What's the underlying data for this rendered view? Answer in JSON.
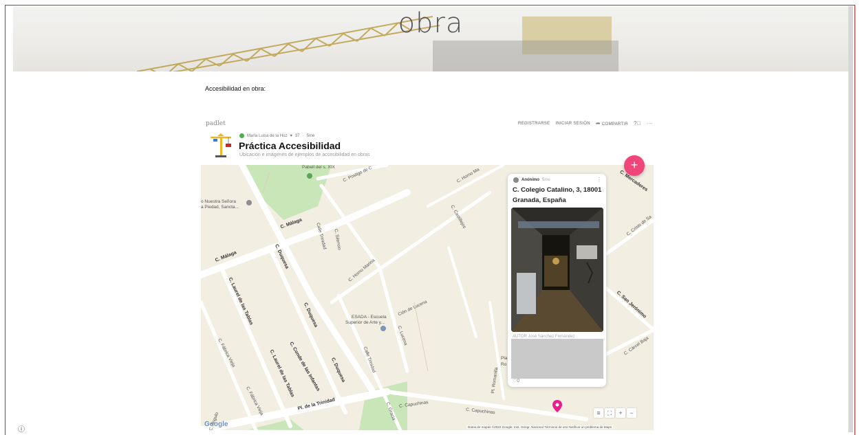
{
  "banner": {
    "title": "obra"
  },
  "intro_text": "Accesibilidad en obra:",
  "padlet": {
    "logo": "padlet",
    "nav": {
      "register": "REGISTRARSE",
      "login": "INICIAR SESIÓN",
      "share": "COMPARTIR",
      "help_icon": "help-circle-icon",
      "more": "···"
    },
    "author": "María Luisa de la Hoz",
    "likes": "37",
    "age": "5me",
    "title": "Práctica Accesibilidad",
    "subtitle": "Ubicación e imágenes de ejemplos de accesibilidad en obras",
    "fab": "+"
  },
  "card": {
    "author": "Anónimo",
    "time": "5me",
    "title": "C. Colegio Catalino, 3, 18001 Granada, España",
    "caption": "AUTOR José Sánchez Fernández",
    "likes": "0"
  },
  "map": {
    "places": {
      "church_1": "o Nuestra Señora",
      "church_2": "a Piedad, Sancta...",
      "esada_1": "ESADA - Escuela",
      "esada_2": "Superior de Arte y...",
      "top_park": "Pabell del s. XIX",
      "pla": "Pla",
      "ro": "Ro"
    },
    "streets": {
      "malaga_1": "C. Málaga",
      "malaga_2": "C. Málaga",
      "duquesa_1": "C. Duquesa",
      "duquesa_2": "C. Duquesa",
      "duquesa_3": "C. Duquesa",
      "laurel_1": "C. Laurel de las Tablas",
      "laurel_2": "C. Laurel de las Tablas",
      "conde": "C. Conde de las Infantas",
      "trinidad_pl": "Pl. de la Trinidad",
      "trinidad_calle": "Calle Trinidad",
      "trinidad_calle_2": "Calle Trinidad",
      "silencio": "C. Silencio",
      "horno_marina": "C. Horno Marina",
      "postigo": "C. Postigo de C",
      "horno_ma": "C. Horno Ma",
      "castillejos": "C. Castillejos",
      "cion_lucena": "Ción de Lucena",
      "lucena": "C. Lucena",
      "mercaderes": "C. Mercaderes",
      "cristo": "C. Cristo de Sa",
      "san_jeronimo": "C. San Jerónimo",
      "carcel_baja": "C. Cárcel Baja",
      "capuchinas_1": "C. Capuchinas",
      "capuchinas_2": "C. Capuchinas",
      "fabrica_vieja_1": "C. Fábrica Vieja",
      "fabrica_vieja_2": "C. Fábrica Vieja",
      "romanilla": "Pl. Romanilla",
      "angulo": "C. Angulo",
      "gracia": "C. Gracia"
    },
    "attribution": "Datos de mapas ©2022 Google, Inst. Geogr. Nacional   Términos de uso   Notificar un problema de Maps",
    "google": "Google",
    "controls": {
      "zoom_in": "+",
      "zoom_out": "−"
    }
  },
  "colors": {
    "fab": "#f0457a",
    "pin": "#e91e8c",
    "park": "#c9e6b8",
    "road": "#ffffff",
    "frame": "#c62828"
  }
}
